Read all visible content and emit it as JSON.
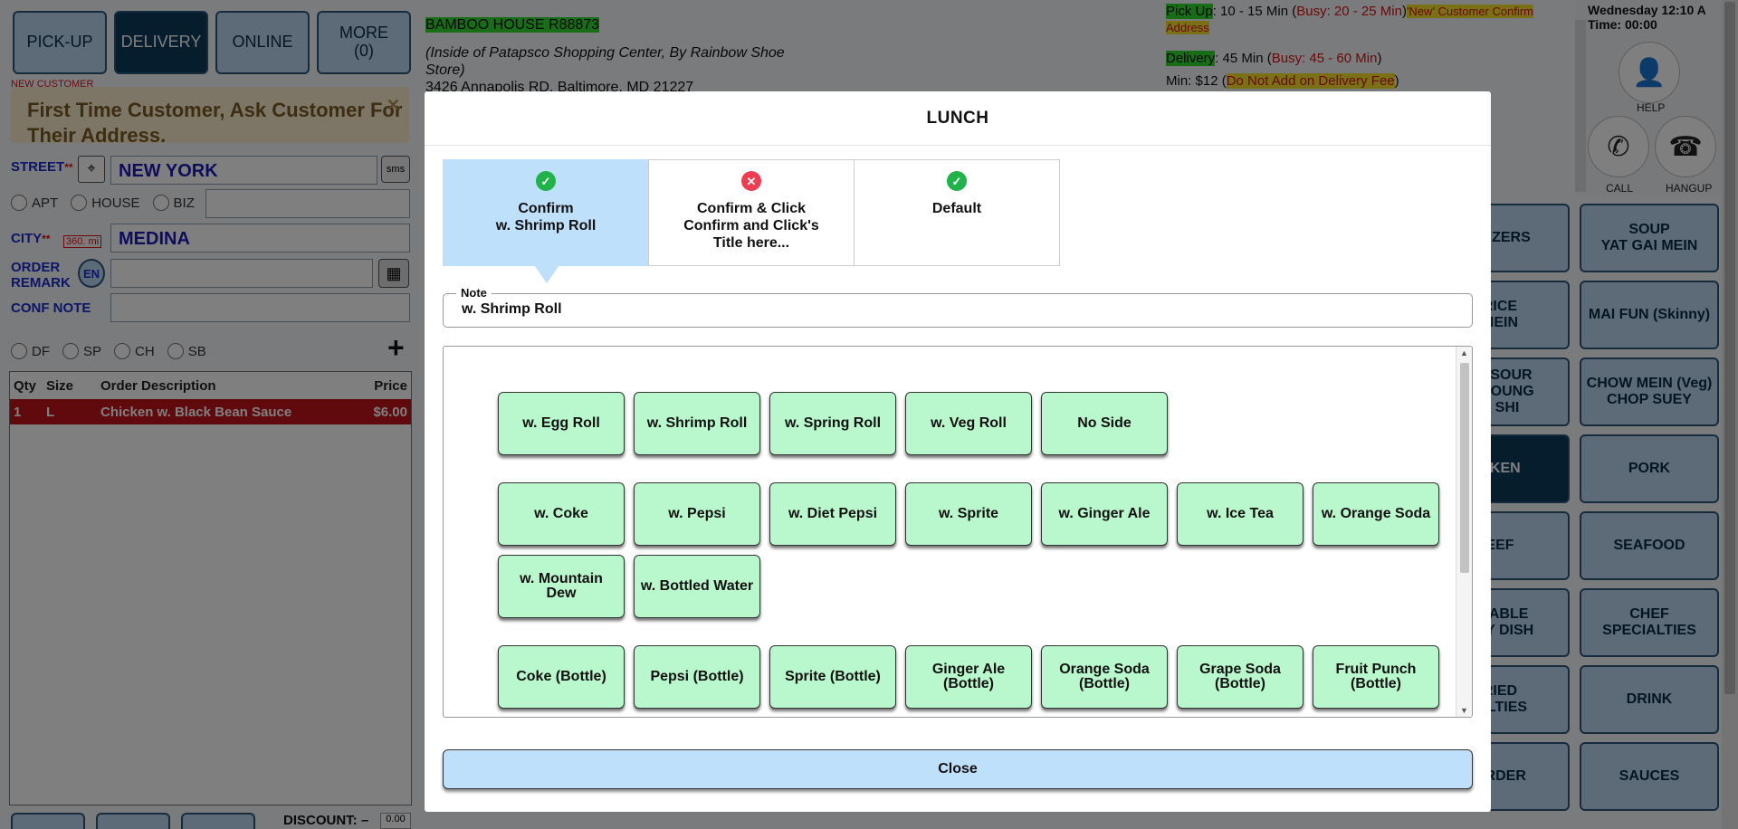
{
  "order_types": [
    {
      "label": "PICK-UP"
    },
    {
      "label": "DELIVERY"
    },
    {
      "label": "ONLINE"
    },
    {
      "label": "MORE\n(0)"
    }
  ],
  "customer": {
    "new_customer_label": "NEW CUSTOMER",
    "first_time_message": "First Time Customer, Ask Customer For Their Address.",
    "close_glyph": "✕",
    "street_label": "STREET",
    "street_value": "NEW YORK",
    "sms_label": "sms",
    "address_types": [
      "APT",
      "HOUSE",
      "BIZ"
    ],
    "city_label": "CITY",
    "distance": "360.",
    "distance_unit": "mi",
    "city_value": "MEDINA",
    "order_remark_label": "ORDER REMARK",
    "lang_label": "EN",
    "conf_note_label": "CONF NOTE",
    "flags": [
      "DF",
      "SP",
      "CH",
      "SB"
    ],
    "add_glyph": "+"
  },
  "order_table": {
    "headers": [
      "Qty",
      "Size",
      "Order Description",
      "Price"
    ],
    "rows": [
      {
        "qty": "1",
        "size": "L",
        "desc": "Chicken w. Black Bean Sauce",
        "price": "$6.00"
      }
    ]
  },
  "discount_label": "DISCOUNT: –",
  "discount_value": "0.00",
  "store": {
    "name": "BAMBOO HOUSE R88873",
    "location_note": "(Inside of Patapsco Shopping Center, By Rainbow Shoe Store)",
    "address": "3426 Annapolis RD, Baltimore, MD 21227"
  },
  "info": {
    "pickup_label": "Pick Up",
    "pickup_time": ": 10 - 15 Min (",
    "pickup_busy": "Busy: 20 - 25 Min",
    "pickup_close": ")",
    "new_customer_note": "'New' Customer Confirm Address",
    "delivery_label": "Delivery",
    "delivery_time": ": 45 Min (",
    "delivery_busy": "Busy: 45 - 60 Min",
    "delivery_close": ")",
    "min_label": "Min: $12 (",
    "min_warning": "Do Not Add on Delivery Fee",
    "min_close": ")"
  },
  "clock": {
    "date": "Wednesday 12:10 A",
    "time": "Time: 00:00"
  },
  "phone": {
    "help": "HELP",
    "call": "CALL",
    "hangup": "HANGUP"
  },
  "categories_left": [
    "ETIZERS",
    "RICE\nMEIN",
    "ET SOUR\nO YOUNG\nU SHI",
    "CKEN",
    "EEF",
    "ETABLE\nTHY DISH",
    "RIED\nIALTIES",
    "ORDER"
  ],
  "categories_right": [
    "SOUP\nYAT GAI MEIN",
    "MAI FUN (Skinny)",
    "CHOW MEIN (Veg)\nCHOP SUEY",
    "PORK",
    "SEAFOOD",
    "CHEF\nSPECIALTIES",
    "DRINK",
    "SAUCES"
  ],
  "modal": {
    "title": "LUNCH",
    "tabs": [
      {
        "label": "Confirm\nw. Shrimp Roll",
        "status": "ok"
      },
      {
        "label": "Confirm & Click\nConfirm and Click's\nTitle here...",
        "status": "bad"
      },
      {
        "label": "Default",
        "status": "ok"
      }
    ],
    "note_label": "Note",
    "note_value": "w. Shrimp Roll",
    "options_rolls": [
      "w. Egg Roll",
      "w. Shrimp Roll",
      "w. Spring Roll",
      "w. Veg Roll",
      "No Side"
    ],
    "options_drinks": [
      "w. Coke",
      "w. Pepsi",
      "w. Diet Pepsi",
      "w. Sprite",
      "w. Ginger Ale",
      "w. Ice Tea",
      "w. Orange Soda",
      "w. Mountain Dew",
      "w. Bottled Water"
    ],
    "options_bottles": [
      "Coke (Bottle)",
      "Pepsi (Bottle)",
      "Sprite (Bottle)",
      "Ginger Ale (Bottle)",
      "Orange Soda (Bottle)",
      "Grape Soda (Bottle)",
      "Fruit Punch (Bottle)"
    ],
    "close_label": "Close"
  }
}
